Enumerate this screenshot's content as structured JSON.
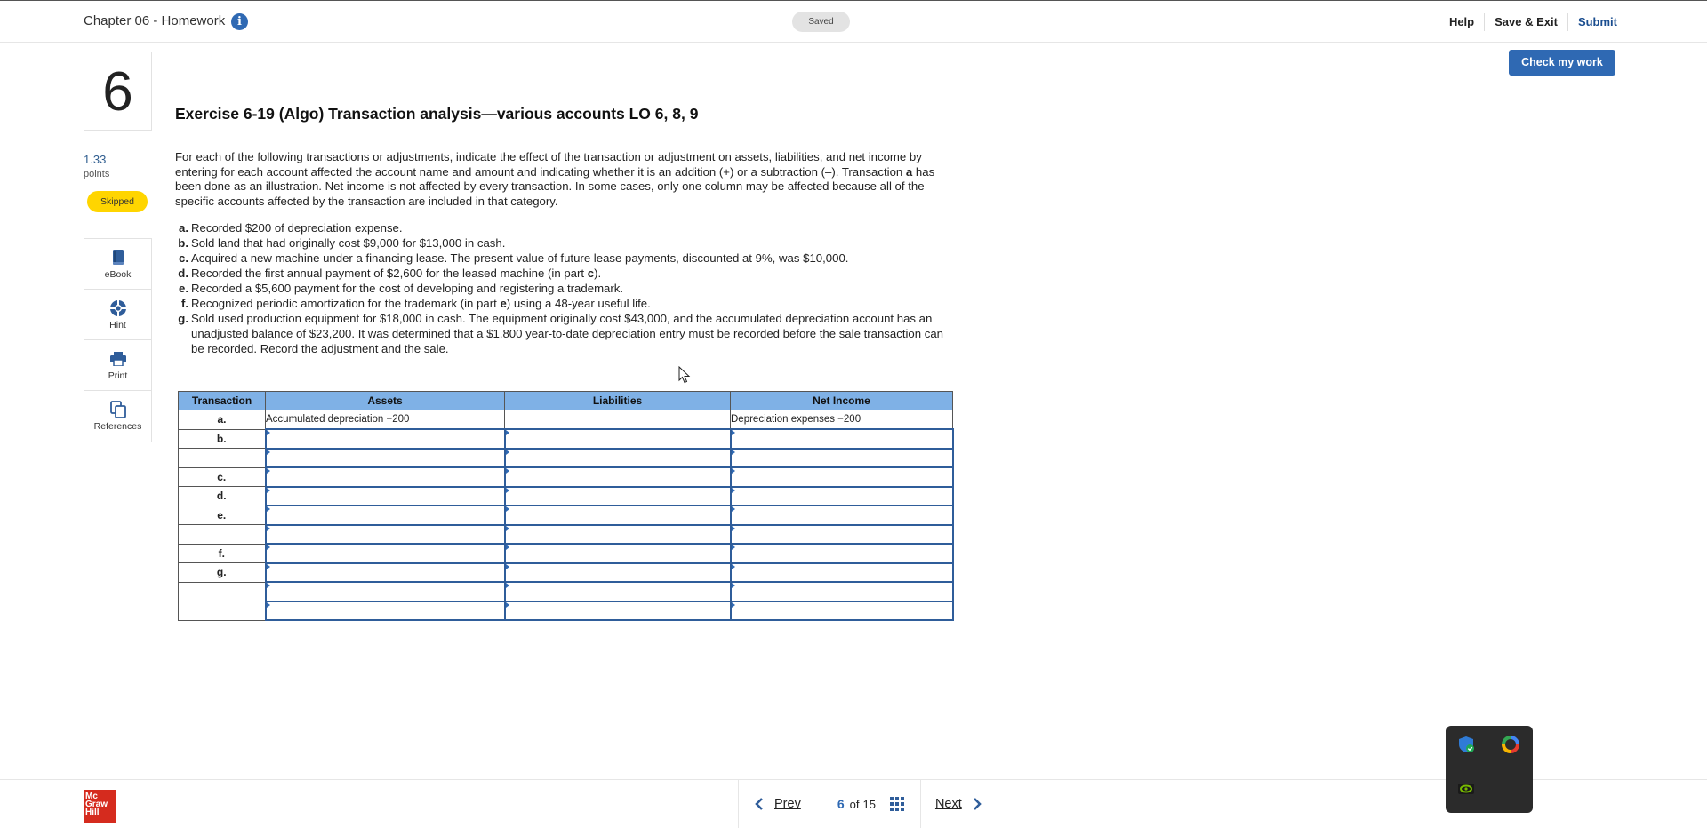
{
  "header": {
    "title": "Chapter 06 - Homework",
    "info_glyph": "i",
    "saved": "Saved",
    "links": [
      "Help",
      "Save & Exit",
      "Submit"
    ]
  },
  "question": {
    "number": "6",
    "points_value": "1.33",
    "points_label": "points",
    "status": "Skipped"
  },
  "tools": [
    {
      "label": "eBook",
      "icon": "book-icon"
    },
    {
      "label": "Hint",
      "icon": "lifebuoy-icon"
    },
    {
      "label": "Print",
      "icon": "printer-icon"
    },
    {
      "label": "References",
      "icon": "copy-icon"
    }
  ],
  "check_button": "Check my work",
  "exercise": {
    "title": "Exercise 6-19 (Algo) Transaction analysis—various accounts LO 6, 8, 9",
    "instructions": [
      "For each of the following transactions or adjustments, indicate the effect of the transaction or adjustment on assets, liabilities, and net income by entering for each account affected the account name and amount and indicating whether it is an addition (+) or a subtraction (–). Transaction ",
      "a",
      " has been done as an illustration. Net income is not affected by every transaction. In some cases, only one column may be affected because all of the specific accounts affected by the transaction are included in that category."
    ],
    "transactions": [
      {
        "letter": "a.",
        "parts": [
          "Recorded $200 of depreciation expense."
        ]
      },
      {
        "letter": "b.",
        "parts": [
          "Sold land that had originally cost $9,000 for $13,000 in cash."
        ]
      },
      {
        "letter": "c.",
        "parts": [
          "Acquired a new machine under a financing lease. The present value of future lease payments, discounted at 9%, was $10,000."
        ]
      },
      {
        "letter": "d.",
        "parts": [
          "Recorded the first annual payment of $2,600 for the leased machine (in part ",
          "c",
          ")."
        ]
      },
      {
        "letter": "e.",
        "parts": [
          "Recorded a $5,600 payment for the cost of developing and registering a trademark."
        ]
      },
      {
        "letter": "f.",
        "parts": [
          "Recognized periodic amortization for the trademark (in part ",
          "e",
          ") using a 48-year useful life."
        ]
      },
      {
        "letter": "g.",
        "parts": [
          "Sold used production equipment for $18,000 in cash. The equipment originally cost $43,000, and the accumulated depreciation account has an unadjusted balance of $23,200. It was determined that a $1,800 year-to-date depreciation entry must be recorded before the sale transaction can be recorded. Record the adjustment and the sale."
        ]
      }
    ]
  },
  "table": {
    "headers": [
      "Transaction",
      "Assets",
      "Liabilities",
      "Net Income"
    ],
    "example_row": {
      "tx": "a.",
      "assets": "Accumulated depreciation −200",
      "liabilities": "",
      "net_income": "Depreciation expenses −200"
    },
    "row_labels": [
      "b.",
      "",
      "c.",
      "d.",
      "e.",
      "",
      "f.",
      "g.",
      "",
      ""
    ]
  },
  "footer": {
    "logo_lines": [
      "Mc",
      "Graw",
      "Hill"
    ],
    "prev": "Prev",
    "current_page": "6",
    "of": "of",
    "total_pages": "15",
    "next": "Next"
  },
  "colors": {
    "accent": "#2f69b3",
    "table_header": "#7fb1e6",
    "skipped_badge": "#ffd500",
    "logo": "#d52b1e"
  }
}
